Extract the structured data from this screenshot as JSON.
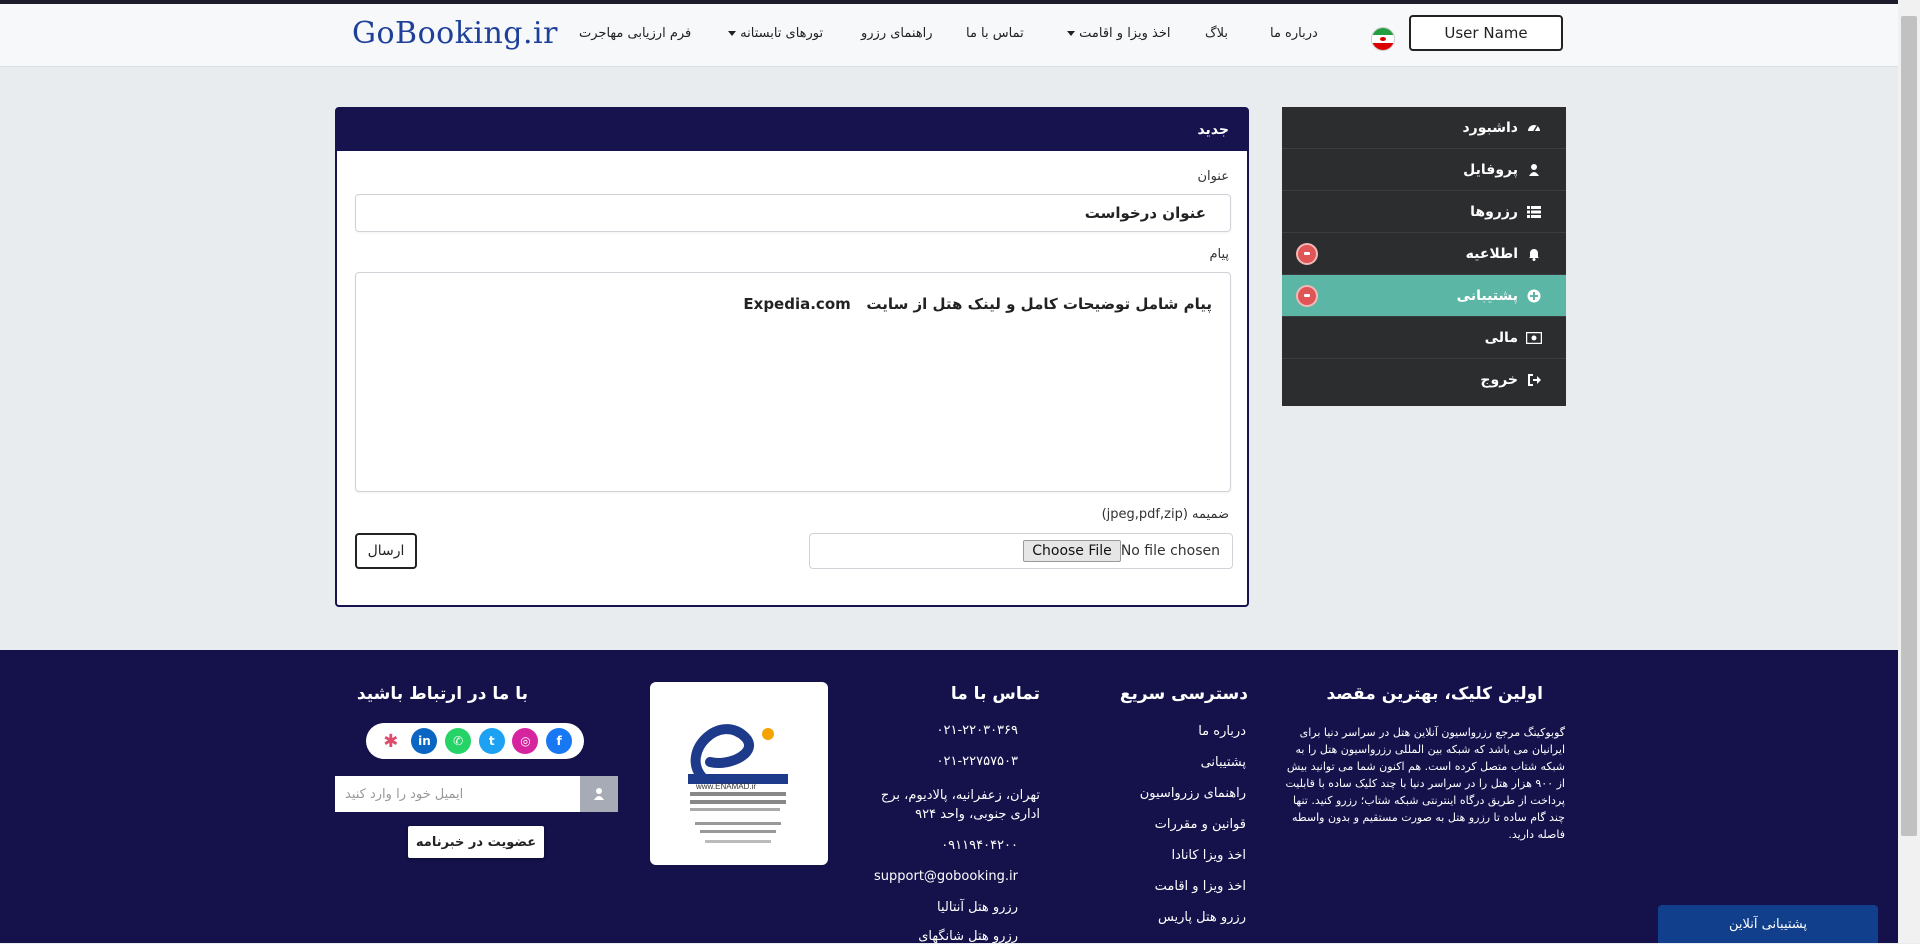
{
  "header": {
    "logo_main": "GoBooking",
    "logo_tld": ".ir",
    "nav": [
      {
        "label": "فرم ارزیابی مهاجرت",
        "dropdown": false
      },
      {
        "label": "تورهای تابستانه",
        "dropdown": true
      },
      {
        "label": "راهنمای رزرو",
        "dropdown": false
      },
      {
        "label": "تماس با ما",
        "dropdown": false
      },
      {
        "label": "اخذ ویزا و اقامت",
        "dropdown": true
      },
      {
        "label": "بلاگ",
        "dropdown": false
      },
      {
        "label": "درباره ما",
        "dropdown": false
      }
    ],
    "user_button": "User Name"
  },
  "sidebar": {
    "items": [
      {
        "label": "داشبورد",
        "icon": "dashboard-icon",
        "active": false,
        "badge": false
      },
      {
        "label": "پروفایل",
        "icon": "user-icon",
        "active": false,
        "badge": false
      },
      {
        "label": "رزروها",
        "icon": "list-icon",
        "active": false,
        "badge": false
      },
      {
        "label": "اطلاعیه",
        "icon": "bell-icon",
        "active": false,
        "badge": true
      },
      {
        "label": "پشتیبانی",
        "icon": "plus-circle-icon",
        "active": true,
        "badge": true
      },
      {
        "label": "مالی",
        "icon": "money-icon",
        "active": false,
        "badge": false
      },
      {
        "label": "خروج",
        "icon": "logout-icon",
        "active": false,
        "badge": false
      }
    ]
  },
  "form": {
    "header": "جدید",
    "title_label": "عنوان",
    "title_value": "عنوان درخواست",
    "message_label": "پیام",
    "message_value": "پیام شامل توضیحات کامل و لینک هتل از سایت",
    "message_value_latin": "Expedia.com",
    "attachment_label": "ضمیمه (jpeg,pdf,zip)",
    "file_button": "Choose File",
    "file_status": "No file chosen",
    "submit_label": "ارسال"
  },
  "footer": {
    "about_title": "اولین کلیک، بهترین مقصد",
    "about_text": "گوبوکینگ مرجع رزرواسیون آنلاین هتل در سراسر دنیا برای ایرانیان می باشد که شبکه بین المللی رزرواسیون هتل را به شبکه شتاب متصل کرده است. هم اکنون شما می توانید بیش از ۹۰۰ هزار هتل را در سراسر دنیا با چند کلیک ساده با قابلیت پرداخت از طریق درگاه اینترنتی شبکه شتاب؛ رزرو کنید. تنها چند گام ساده تا رزرو هتل به صورت مستقیم و بدون واسطه فاصله دارید.",
    "quick_title": "دسترسی سریع",
    "quick_links": [
      "درباره ما",
      "پشتیبانی",
      "راهنمای رزرواسیون",
      "قوانین و مقررات",
      "اخذ ویزا کانادا",
      "اخذ ویزا و اقامت",
      "رزرو هتل پاریس"
    ],
    "contact_title": "تماس با ما",
    "contact_items": [
      "۰۲۱-۲۲۰۳۰۳۶۹",
      "۰۲۱-۲۲۷۵۷۵۰۳",
      "تهران، زعفرانیه، پالادیوم، برج اداری جنوبی، واحد ۹۲۴",
      "۰۹۱۱۹۴۰۴۲۰۰",
      "support@gobooking.ir",
      "رزرو هتل آنتالیا",
      "رزرو هتل شانگهای"
    ],
    "social_title": "با ما در ارتباط باشید",
    "socials": [
      "facebook-icon",
      "instagram-icon",
      "twitter-icon",
      "whatsapp-icon",
      "linkedin-icon",
      "aparat-icon"
    ],
    "email_placeholder": "ایمیل خود را وارد کنید",
    "subscribe_label": "عضویت در خبرنامه",
    "online_support": "پشتیبانی آنلاین",
    "enamad_text": "www.ENAMAD.ir"
  }
}
